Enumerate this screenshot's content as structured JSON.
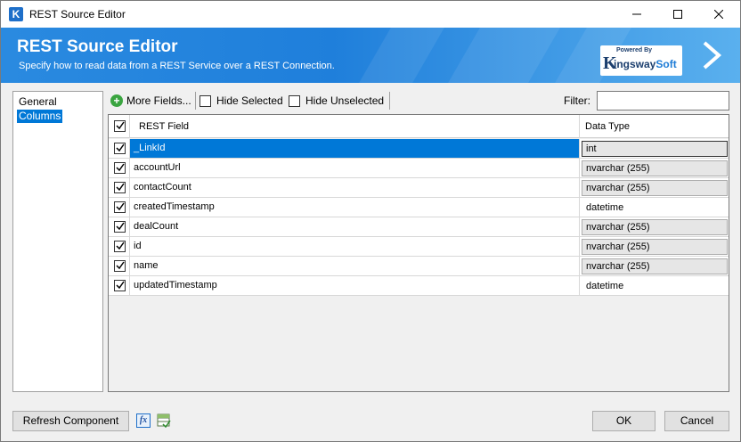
{
  "window": {
    "title": "REST Source Editor"
  },
  "banner": {
    "title": "REST Source Editor",
    "subtitle": "Specify how to read data from a REST Service over a REST Connection.",
    "logo_powered": "Powered By",
    "logo_k": "K",
    "logo_brand_a": "ingsway",
    "logo_brand_b": "Soft"
  },
  "nav": {
    "items": [
      {
        "label": "General",
        "selected": false
      },
      {
        "label": "Columns",
        "selected": true
      }
    ]
  },
  "toolbar": {
    "more_fields_label": "More Fields...",
    "hide_selected_label": "Hide Selected",
    "hide_unselected_label": "Hide Unselected",
    "filter_label": "Filter:",
    "filter_value": ""
  },
  "grid": {
    "headers": {
      "field": "REST Field",
      "type": "Data Type"
    },
    "rows": [
      {
        "field": "_LinkId",
        "type": "int",
        "checked": true,
        "selected": true,
        "editable_type": false
      },
      {
        "field": "accountUrl",
        "type": "nvarchar (255)",
        "checked": true,
        "selected": false,
        "editable_type": false
      },
      {
        "field": "contactCount",
        "type": "nvarchar (255)",
        "checked": true,
        "selected": false,
        "editable_type": false
      },
      {
        "field": "createdTimestamp",
        "type": "datetime",
        "checked": true,
        "selected": false,
        "editable_type": true
      },
      {
        "field": "dealCount",
        "type": "nvarchar (255)",
        "checked": true,
        "selected": false,
        "editable_type": false
      },
      {
        "field": "id",
        "type": "nvarchar (255)",
        "checked": true,
        "selected": false,
        "editable_type": false
      },
      {
        "field": "name",
        "type": "nvarchar (255)",
        "checked": true,
        "selected": false,
        "editable_type": false
      },
      {
        "field": "updatedTimestamp",
        "type": "datetime",
        "checked": true,
        "selected": false,
        "editable_type": true
      }
    ]
  },
  "footer": {
    "refresh_label": "Refresh Component",
    "fx_icon": "fx",
    "ok_label": "OK",
    "cancel_label": "Cancel"
  },
  "colors": {
    "accent": "#0078d7",
    "banner": "#1f7fdb"
  }
}
